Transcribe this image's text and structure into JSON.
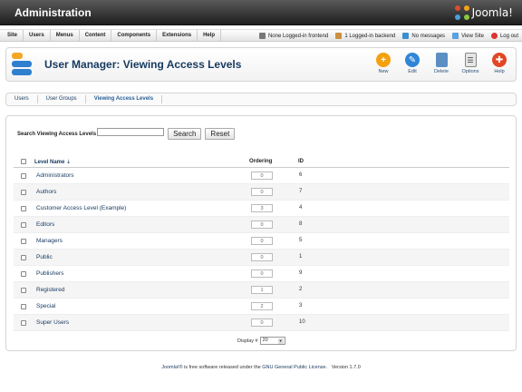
{
  "header": {
    "title": "Administration",
    "logo_text": "Joomla!"
  },
  "menu": [
    "Site",
    "Users",
    "Menus",
    "Content",
    "Components",
    "Extensions",
    "Help"
  ],
  "status": {
    "frontend": "None Logged-in frontend",
    "backend": "1 Logged-in backend",
    "messages": "No messages",
    "view_site": "View Site",
    "logout": "Log out"
  },
  "toolbar": {
    "page_title": "User Manager: Viewing Access Levels",
    "buttons": [
      {
        "label": "New",
        "icon": "plus-icon"
      },
      {
        "label": "Edit",
        "icon": "pencil-icon"
      },
      {
        "label": "Delete",
        "icon": "trash-icon"
      },
      {
        "label": "Options",
        "icon": "options-icon"
      },
      {
        "label": "Help",
        "icon": "lifebuoy-icon"
      }
    ]
  },
  "submenu": [
    "Users",
    "User Groups",
    "Viewing Access Levels"
  ],
  "filter": {
    "label": "Search Viewing Access Levels",
    "value": "",
    "search_label": "Search",
    "reset_label": "Reset"
  },
  "table": {
    "headers": {
      "name": "Level Name",
      "ordering": "Ordering",
      "id": "ID"
    },
    "rows": [
      {
        "name": "Administrators",
        "ordering": "0",
        "id": "6"
      },
      {
        "name": "Authors",
        "ordering": "0",
        "id": "7"
      },
      {
        "name": "Customer Access Level (Example)",
        "ordering": "3",
        "id": "4"
      },
      {
        "name": "Editors",
        "ordering": "0",
        "id": "8"
      },
      {
        "name": "Managers",
        "ordering": "0",
        "id": "5"
      },
      {
        "name": "Public",
        "ordering": "0",
        "id": "1"
      },
      {
        "name": "Publishers",
        "ordering": "0",
        "id": "9"
      },
      {
        "name": "Registered",
        "ordering": "1",
        "id": "2"
      },
      {
        "name": "Special",
        "ordering": "2",
        "id": "3"
      },
      {
        "name": "Super Users",
        "ordering": "0",
        "id": "10"
      }
    ]
  },
  "pagination": {
    "display_label": "Display #",
    "display_value": "20"
  },
  "footer": {
    "joomla": "Joomla!®",
    "text": "is free software released under the",
    "license": "GNU General Public License.",
    "version": "Version 1.7.0"
  }
}
